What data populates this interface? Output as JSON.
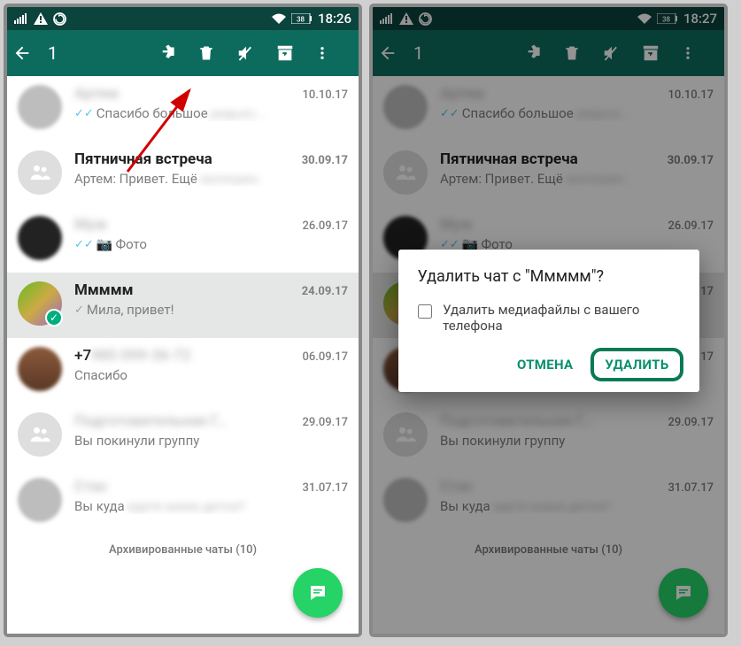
{
  "status": {
    "time_left": "18:26",
    "time_right": "18:27",
    "battery": "38"
  },
  "toolbar": {
    "selected_count": "1"
  },
  "chats": [
    {
      "name": "Артем",
      "name_blur": true,
      "date": "10.10.17",
      "msg_prefix": "✓✓",
      "msg": "Спасибо большое ",
      "msg_blur_tail": "редько...",
      "avatar": "blurred grey",
      "read": true
    },
    {
      "name": "Пятничная встреча",
      "name_bold": true,
      "date": "30.09.17",
      "msg": "Артем: Привет. Ещё ",
      "msg_blur_tail": "хеллоуин.",
      "avatar": "group"
    },
    {
      "name": "Муж",
      "name_blur": true,
      "date": "26.09.17",
      "msg_prefix": "✓✓",
      "msg_icon": "📷",
      "msg": " Фото",
      "avatar": "dark blurred",
      "read": true
    },
    {
      "name": "Ммммм",
      "name_bold": true,
      "date": "24.09.17",
      "msg_prefix": "✓",
      "msg": " Мила, привет!",
      "avatar": "colored",
      "selected": true
    },
    {
      "name": "+7 ",
      "name_blur_tail": "985 099-36-72",
      "date": "06.09.17",
      "msg": "Спасибо",
      "avatar": "brown blurred"
    },
    {
      "name": "Подготовительная Г…",
      "name_blur": true,
      "date": "29.09.17",
      "msg": "Вы покинули группу",
      "avatar": "group"
    },
    {
      "name": "Стас",
      "name_blur": true,
      "date": "31.07.17",
      "msg": "Вы куда ",
      "msg_blur_tail": "едете мама детки?",
      "avatar": "grey blurred"
    }
  ],
  "archived": "Архивированные чаты (10)",
  "dialog": {
    "title": "Удалить чат с \"Ммммм\"?",
    "checkbox_label": "Удалить медиафайлы с вашего телефона",
    "cancel": "ОТМЕНА",
    "confirm": "УДАЛИТЬ"
  }
}
